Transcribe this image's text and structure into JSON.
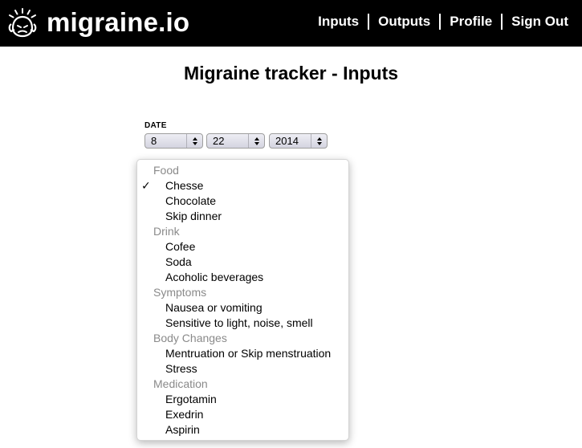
{
  "header": {
    "brand": "migraine.io",
    "logo_icon": "migraine-head-icon",
    "nav": [
      {
        "label": "Inputs"
      },
      {
        "label": "Outputs"
      },
      {
        "label": "Profile"
      },
      {
        "label": "Sign Out"
      }
    ]
  },
  "page": {
    "title": "Migraine tracker - Inputs"
  },
  "date": {
    "label": "DATE",
    "month": "8",
    "day": "22",
    "year": "2014"
  },
  "dropdown": {
    "selected": "Chesse",
    "check_glyph": "✓",
    "groups": [
      {
        "label": "Food",
        "items": [
          "Chesse",
          "Chocolate",
          "Skip dinner"
        ]
      },
      {
        "label": "Drink",
        "items": [
          "Cofee",
          "Soda",
          "Acoholic beverages"
        ]
      },
      {
        "label": "Symptoms",
        "items": [
          "Nausea or vomiting",
          "Sensitive to light, noise, smell"
        ]
      },
      {
        "label": "Body Changes",
        "items": [
          "Mentruation or Skip menstruation",
          "Stress"
        ]
      },
      {
        "label": "Medication",
        "items": [
          "Ergotamin",
          "Exedrin",
          "Aspirin"
        ]
      }
    ]
  },
  "colors": {
    "header_bg": "#000000",
    "header_text": "#ffffff",
    "group_label": "#8a8a8a"
  }
}
